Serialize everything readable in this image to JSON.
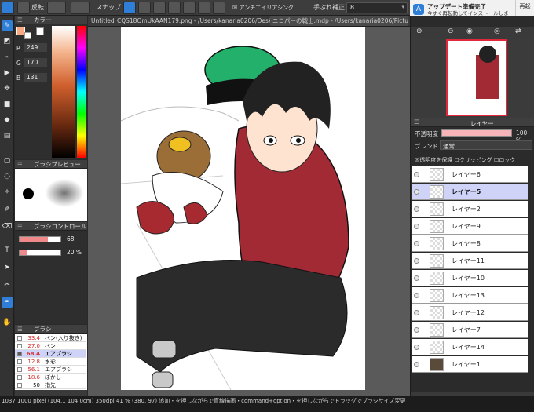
{
  "toolbar": {
    "left_label": "反転",
    "snap_label": "スナップ",
    "antialias_label": "アンチエイリアシング",
    "stabilizer_label": "手ぶれ補正",
    "stabilizer_value": "8"
  },
  "notification": {
    "title": "アップデート準備完了",
    "body": "今すぐ再起動してインストールしますか？夜間に行いますか？",
    "restart_label": "再起",
    "later_label": "後で"
  },
  "tabs": [
    {
      "label": "Untitled"
    },
    {
      "label": "CQS18OmUkAAN179.png - /Users/kanaria0206/Desktop"
    },
    {
      "label": "ニコパーの戦士.mdp - /Users/kanaria0206/Pictures"
    }
  ],
  "color_panel": {
    "title": "カラー",
    "r_label": "R",
    "r_value": "249",
    "g_label": "G",
    "g_value": "170",
    "b_label": "B",
    "b_value": "131",
    "fg_color": "#f9aa83"
  },
  "brush_preview": {
    "title": "ブラシプレビュー"
  },
  "brush_control": {
    "title": "ブラシコントロール",
    "size_value": "68",
    "opacity_value": "20 %"
  },
  "brush_list": {
    "title": "ブラシ",
    "items": [
      {
        "num": "33.4",
        "name": "ペン(入り抜き)"
      },
      {
        "num": "27.0",
        "name": "ペン"
      },
      {
        "num": "68.4",
        "name": "エアブラシ"
      },
      {
        "num": "12.8",
        "name": "水彩"
      },
      {
        "num": "56.1",
        "name": "エアブラシ"
      },
      {
        "num": "18.6",
        "name": "ぼかし"
      },
      {
        "num": "50",
        "name": "指先"
      }
    ]
  },
  "layer_panel": {
    "title": "レイヤー",
    "opacity_label": "不透明度",
    "opacity_value": "100 %",
    "blend_label": "ブレンド",
    "blend_value": "通常",
    "protect_label": "透明度を保護",
    "clipping_label": "クリッピング",
    "lock_label": "ロック",
    "layers": [
      {
        "name": "レイヤー6"
      },
      {
        "name": "レイヤー5"
      },
      {
        "name": "レイヤー2"
      },
      {
        "name": "レイヤー9"
      },
      {
        "name": "レイヤー8"
      },
      {
        "name": "レイヤー11"
      },
      {
        "name": "レイヤー10"
      },
      {
        "name": "レイヤー13"
      },
      {
        "name": "レイヤー12"
      },
      {
        "name": "レイヤー7"
      },
      {
        "name": "レイヤー14"
      },
      {
        "name": "レイヤー1"
      }
    ]
  },
  "status": {
    "text": "1037 1000 pixel (104.1 104.0cm) 350dpi 41 % (380, 97) 追加・を押しながらで直線描画・command+option・を押しながらでドラッグでブラシサイズ変更"
  },
  "colors": {
    "accent": "#2f7ed8",
    "shirt": "#a22a35",
    "hat": "#23b06a"
  }
}
